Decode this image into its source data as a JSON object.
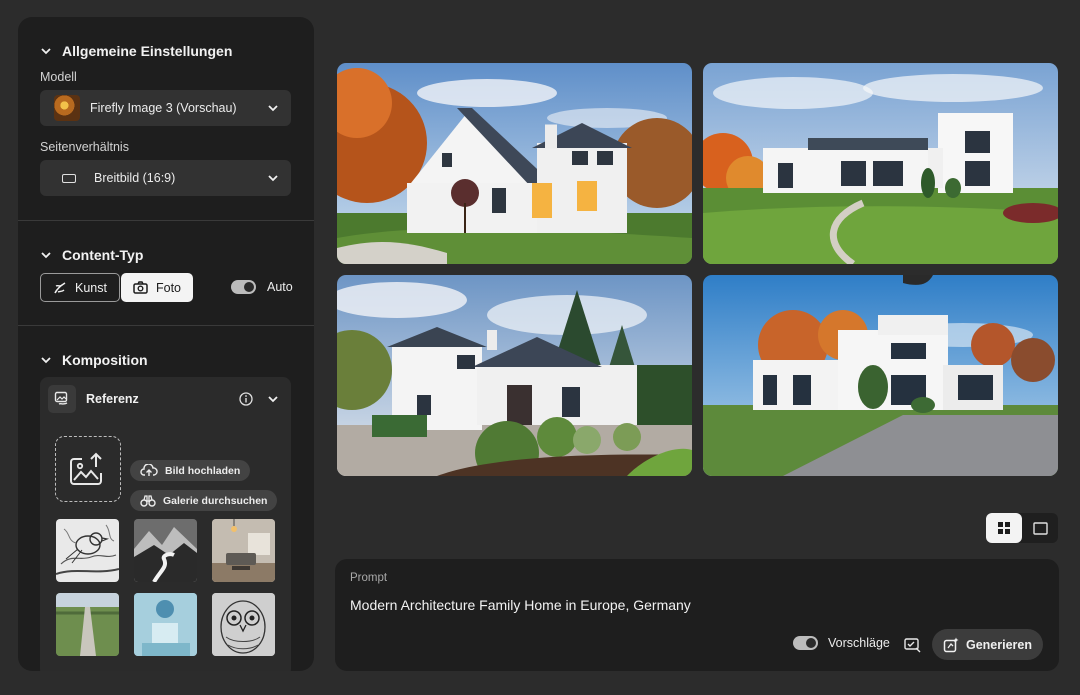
{
  "sidebar": {
    "general": {
      "title": "Allgemeine Einstellungen",
      "model_label": "Modell",
      "model_value": "Firefly Image 3 (Vorschau)",
      "ratio_label": "Seitenverhältnis",
      "ratio_value": "Breitbild (16:9)"
    },
    "content_type": {
      "title": "Content-Typ",
      "kunst_label": "Kunst",
      "foto_label": "Foto",
      "auto_label": "Auto",
      "auto_on": true,
      "selected": "Foto"
    },
    "composition": {
      "title": "Komposition",
      "reference_title": "Referenz",
      "upload_label": "Bild hochladen",
      "gallery_label": "Galerie durchsuchen",
      "thumbnails": [
        "bird-sketch",
        "mountain-river-bw",
        "living-room",
        "field-road",
        "sphere-pedestal",
        "owl-mandala"
      ]
    }
  },
  "results": {
    "images": [
      "autumn-white-gabled-house",
      "modern-flat-roof-villa-lawn",
      "white-villa-garden-pine",
      "modern-cube-house-driveway"
    ],
    "view_mode": "grid"
  },
  "prompt": {
    "label": "Prompt",
    "text": "Modern Architecture Family Home in Europe, Germany",
    "suggestions_label": "Vorschläge",
    "suggestions_on": true,
    "generate_label": "Generieren"
  },
  "colors": {
    "background": "#2c2c2c",
    "panel": "#1e1e1e",
    "accent_light": "#f4f4f4"
  }
}
